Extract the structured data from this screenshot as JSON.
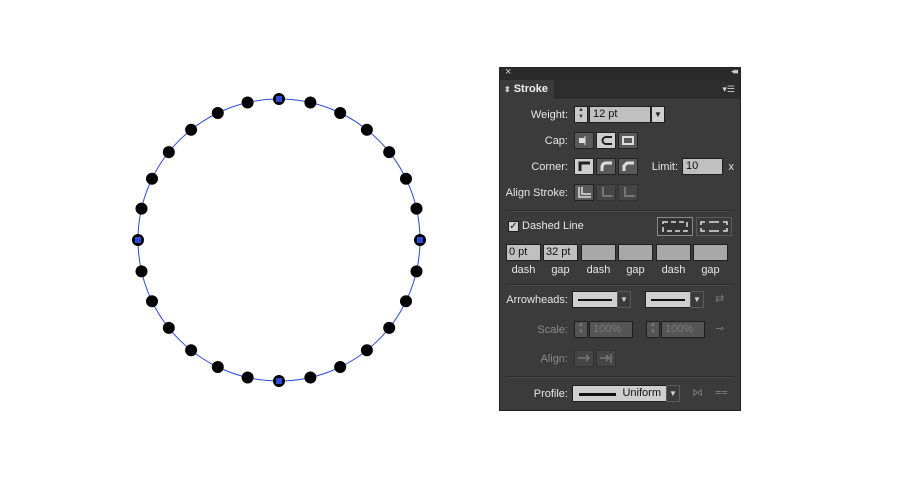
{
  "panel": {
    "tab_label": "Stroke",
    "weight": {
      "label": "Weight:",
      "value": "12 pt"
    },
    "cap": {
      "label": "Cap:",
      "selected": "round"
    },
    "corner": {
      "label": "Corner:",
      "selected": "miter"
    },
    "limit": {
      "label": "Limit:",
      "value": "10",
      "unit": "x"
    },
    "align_stroke": {
      "label": "Align Stroke:",
      "selected": "center"
    },
    "dashed_line": {
      "label": "Dashed Line",
      "checked": true,
      "check_mark": "✓"
    },
    "dashes": [
      {
        "value": "0 pt",
        "label": "dash"
      },
      {
        "value": "32 pt",
        "label": "gap"
      },
      {
        "value": "",
        "label": "dash"
      },
      {
        "value": "",
        "label": "gap"
      },
      {
        "value": "",
        "label": "dash"
      },
      {
        "value": "",
        "label": "gap"
      }
    ],
    "arrowheads": {
      "label": "Arrowheads:"
    },
    "scale": {
      "label": "Scale:",
      "start": "100%",
      "end": "100%"
    },
    "align": {
      "label": "Align:"
    },
    "profile": {
      "label": "Profile:",
      "value": "Uniform"
    }
  },
  "artwork": {
    "path_color": "#2b4bd6",
    "dot_color": "#000000",
    "dot_count": 28
  }
}
